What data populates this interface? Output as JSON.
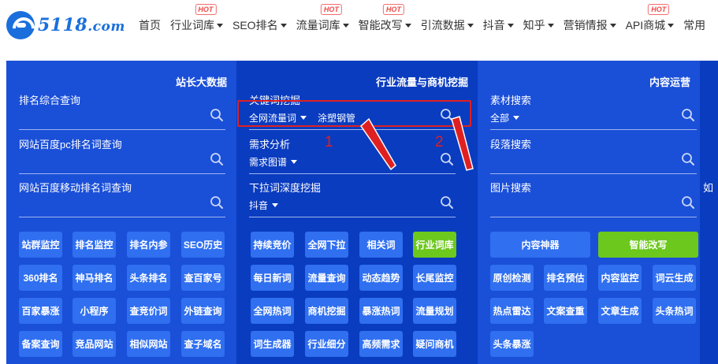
{
  "logo": {
    "main": "5118",
    "suffix": ".com"
  },
  "nav": [
    {
      "label": "首页",
      "caret": false,
      "hot": ""
    },
    {
      "label": "行业词库",
      "caret": true,
      "hot": "HOT"
    },
    {
      "label": "SEO排名",
      "caret": true,
      "hot": ""
    },
    {
      "label": "流量词库",
      "caret": true,
      "hot": "HOT"
    },
    {
      "label": "智能改写",
      "caret": true,
      "hot": "HOT"
    },
    {
      "label": "引流数据",
      "caret": true,
      "hot": ""
    },
    {
      "label": "抖音",
      "caret": true,
      "hot": ""
    },
    {
      "label": "知乎",
      "caret": true,
      "hot": ""
    },
    {
      "label": "营销情报",
      "caret": true,
      "hot": ""
    },
    {
      "label": "API商城",
      "caret": true,
      "hot": "HOT"
    },
    {
      "label": "常用",
      "caret": false,
      "hot": ""
    }
  ],
  "col1": {
    "title": "站长大数据",
    "queries": [
      {
        "label": "排名综合查询"
      },
      {
        "label": "网站百度pc排名词查询"
      },
      {
        "label": "网站百度移动排名词查询"
      }
    ],
    "buttons": [
      "站群监控",
      "排名监控",
      "排名内参",
      "SEO历史",
      "360排名",
      "神马排名",
      "头条排名",
      "查百家号",
      "百家暴涨",
      "小程序",
      "查竞价词",
      "外链查询",
      "备案查询",
      "竞品网站",
      "相似网站",
      "查子域名"
    ]
  },
  "col2": {
    "title": "行业流量与商机挖掘",
    "queries": [
      {
        "label": "关键词挖掘",
        "select": "全网流量词",
        "keyword": "涂塑钢管"
      },
      {
        "label": "需求分析",
        "select": "需求图谱",
        "keyword": ""
      },
      {
        "label": "下拉词深度挖掘",
        "select": "抖音",
        "keyword": ""
      }
    ],
    "buttons": [
      "持续竞价",
      "全网下拉",
      "相关词",
      "行业词库",
      "每日新词",
      "流量查询",
      "动态趋势",
      "长尾监控",
      "全网热词",
      "商机挖掘",
      "暴涨热词",
      "流量规划",
      "词生成器",
      "行业细分",
      "高频需求",
      "疑问商机"
    ]
  },
  "col3": {
    "title": "内容运营",
    "queries": [
      {
        "label": "素材搜索",
        "select": "全部"
      },
      {
        "label": "段落搜索"
      },
      {
        "label": "图片搜索"
      }
    ],
    "wide_buttons": [
      "内容神器",
      "智能改写"
    ],
    "buttons": [
      "原创检测",
      "排名预估",
      "内容监控",
      "词云生成",
      "热点雷达",
      "文案查重",
      "文章生成",
      "头条热词",
      "头条暴涨"
    ]
  },
  "col4": {
    "fragment": "如"
  },
  "annotations": {
    "n1": "1",
    "n2": "2"
  },
  "colors": {
    "brand": "#1a6fdc",
    "panel_light": "#1a4fd8",
    "panel_dark": "#0a3cc0",
    "button": "#2f6ff0",
    "green": "#6cc81c",
    "annotation": "#e02020"
  }
}
